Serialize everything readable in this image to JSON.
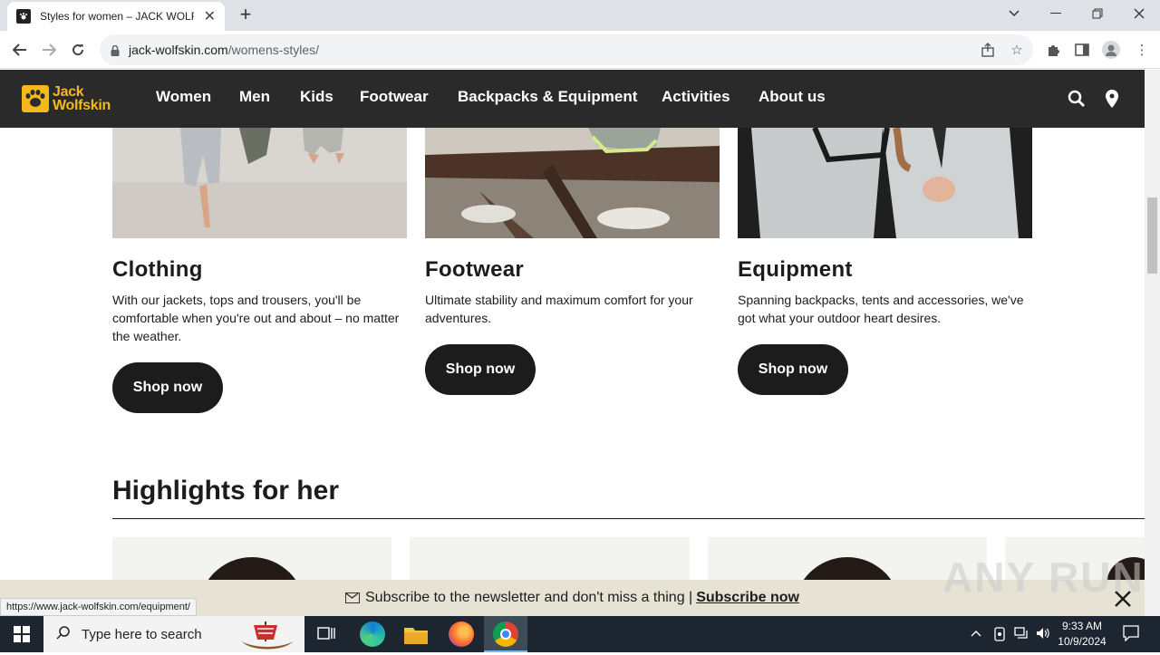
{
  "browser": {
    "tab_title": "Styles for women – JACK WOLFSKIN",
    "url_host": "jack-wolfskin.com",
    "url_path": "/womens-styles/",
    "status_url": "https://www.jack-wolfskin.com/equipment/"
  },
  "site": {
    "logo_line1": "Jack",
    "logo_line2": "Wolfskin",
    "nav": [
      "Women",
      "Men",
      "Kids",
      "Footwear",
      "Backpacks & Equipment",
      "Activities",
      "About us"
    ]
  },
  "categories": [
    {
      "title": "Clothing",
      "desc": "With our jackets, tops and trousers, you'll be comfortable when you're out and about – no matter the weather.",
      "button": "Shop now"
    },
    {
      "title": "Footwear",
      "desc": "Ultimate stability and maximum comfort for your adventures.",
      "button": "Shop now"
    },
    {
      "title": "Equipment",
      "desc": "Spanning backpacks, tents and accessories, we've got what your outdoor heart desires.",
      "button": "Shop now"
    }
  ],
  "highlights": {
    "title": "Highlights for her"
  },
  "newsletter": {
    "text": "Subscribe to the newsletter and don't miss a thing |",
    "link": "Subscribe now"
  },
  "watermark": "ANY RUN",
  "taskbar": {
    "search_placeholder": "Type here to search",
    "time": "9:33 AM",
    "date": "10/9/2024"
  },
  "colors": {
    "brand_yellow": "#f5b91d",
    "nav_bg": "#2a2a2a",
    "button_bg": "#1c1c1c",
    "newsletter_bg": "#e7e3d4"
  }
}
